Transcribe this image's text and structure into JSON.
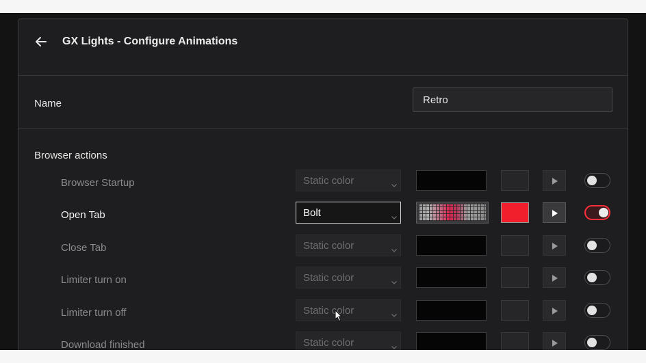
{
  "header": {
    "title": "GX Lights - Configure Animations"
  },
  "name_field": {
    "label": "Name",
    "value": "Retro"
  },
  "section": {
    "title": "Browser actions"
  },
  "colors": {
    "accent": "#ff2f3c",
    "panel": "#1e1e20",
    "active_color": "#f11f2b"
  },
  "rows": [
    {
      "label": "Browser Startup",
      "animation": "Static color",
      "enabled": false
    },
    {
      "label": "Open Tab",
      "animation": "Bolt",
      "enabled": true
    },
    {
      "label": "Close Tab",
      "animation": "Static color",
      "enabled": false
    },
    {
      "label": "Limiter turn on",
      "animation": "Static color",
      "enabled": false
    },
    {
      "label": "Limiter turn off",
      "animation": "Static color",
      "enabled": false
    },
    {
      "label": "Download finished",
      "animation": "Static color",
      "enabled": false
    }
  ]
}
